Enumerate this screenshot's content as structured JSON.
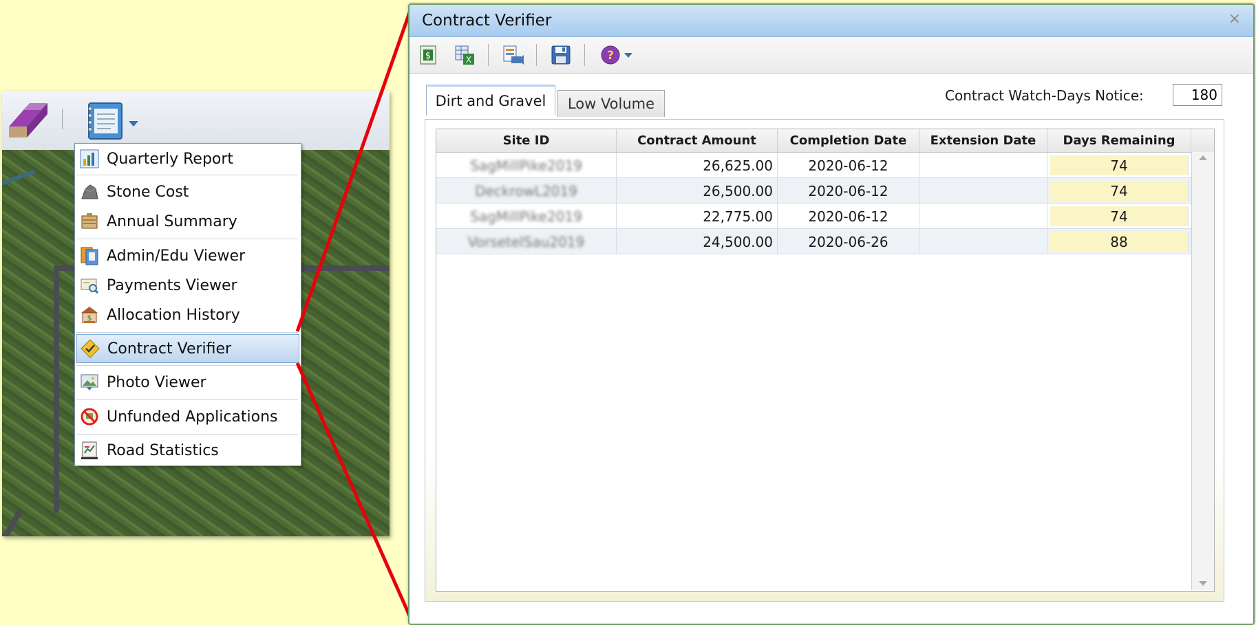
{
  "menu": {
    "items": [
      {
        "label": "Quarterly Report",
        "icon": "quarterly-report-icon"
      },
      {
        "label": "Stone Cost",
        "icon": "stone-cost-icon"
      },
      {
        "label": "Annual Summary",
        "icon": "annual-summary-icon"
      },
      {
        "label": "Admin/Edu Viewer",
        "icon": "admin-edu-viewer-icon"
      },
      {
        "label": "Payments Viewer",
        "icon": "payments-viewer-icon"
      },
      {
        "label": "Allocation History",
        "icon": "allocation-history-icon"
      },
      {
        "label": "Contract Verifier",
        "icon": "contract-verifier-icon",
        "selected": true
      },
      {
        "label": "Photo Viewer",
        "icon": "photo-viewer-icon"
      },
      {
        "label": "Unfunded Applications",
        "icon": "unfunded-applications-icon"
      },
      {
        "label": "Road Statistics",
        "icon": "road-statistics-icon"
      }
    ]
  },
  "dialog": {
    "title": "Contract Verifier",
    "close_label": "×",
    "tabs": [
      {
        "label": "Dirt and Gravel",
        "active": true
      },
      {
        "label": "Low Volume",
        "active": false
      }
    ],
    "watch_days_label": "Contract Watch-Days Notice:",
    "watch_days_value": "180",
    "grid": {
      "columns": [
        "Site ID",
        "Contract Amount",
        "Completion Date",
        "Extension Date",
        "Days Remaining"
      ],
      "rows": [
        {
          "site_id": "SagMillPike2019",
          "amount": "26,625.00",
          "completion": "2020-06-12",
          "extension": "",
          "days": "74"
        },
        {
          "site_id": "DeckrowL2019",
          "amount": "26,500.00",
          "completion": "2020-06-12",
          "extension": "",
          "days": "74"
        },
        {
          "site_id": "SagMillPike2019",
          "amount": "22,775.00",
          "completion": "2020-06-12",
          "extension": "",
          "days": "74"
        },
        {
          "site_id": "VorsetelSau2019",
          "amount": "24,500.00",
          "completion": "2020-06-26",
          "extension": "",
          "days": "88"
        }
      ]
    }
  },
  "colors": {
    "background": "#ffffc6",
    "callout": "#e8000b",
    "days_highlight": "#fbf4c5",
    "titlebar": "#a7cbef"
  }
}
